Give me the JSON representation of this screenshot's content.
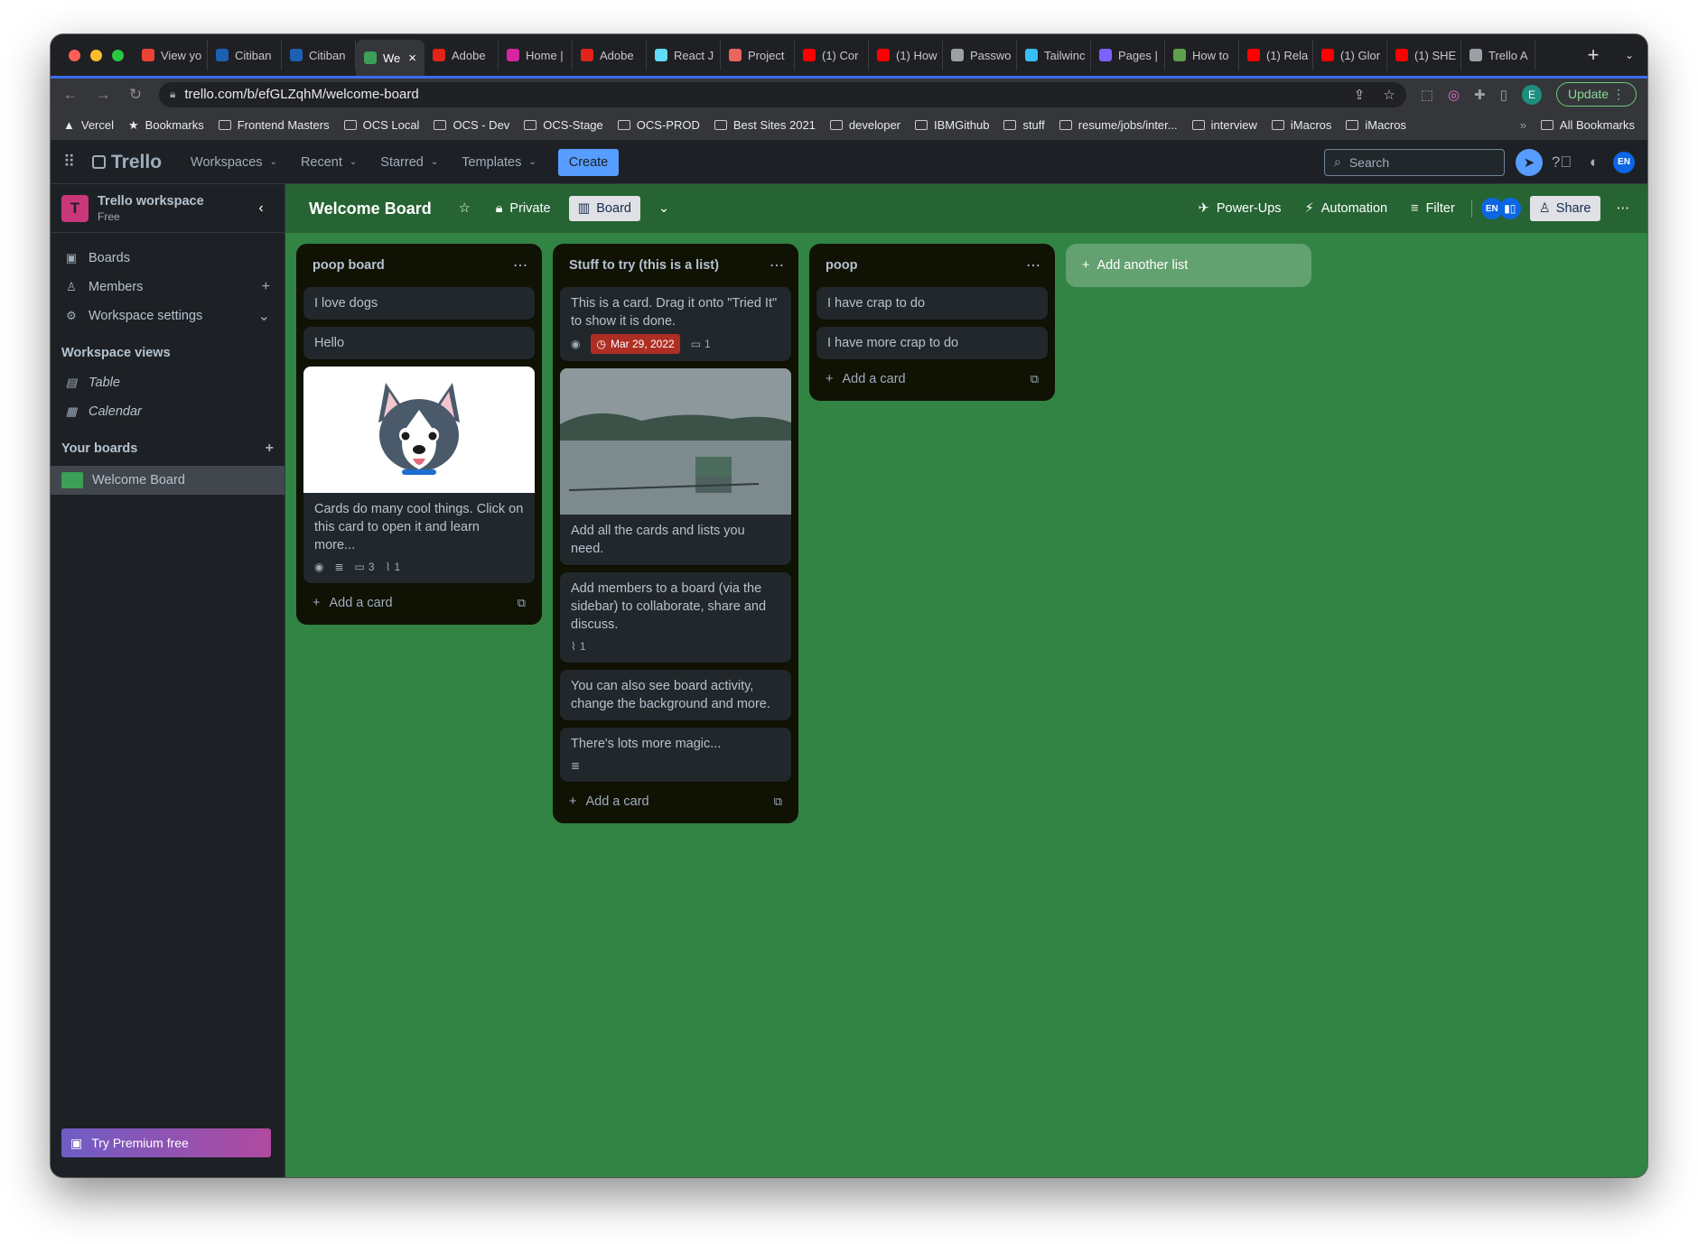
{
  "browser": {
    "tabs": [
      {
        "label": "View yo",
        "icon": "gmail-icon",
        "color": "#ea4335"
      },
      {
        "label": "Citiban",
        "icon": "citi-icon",
        "color": "#1c5fb5"
      },
      {
        "label": "Citiban",
        "icon": "citi-icon",
        "color": "#1c5fb5"
      },
      {
        "label": "We",
        "icon": "trello-icon",
        "color": "#3b9f57",
        "active": true
      },
      {
        "label": "Adobe",
        "icon": "adobe-icon",
        "color": "#e2231a"
      },
      {
        "label": "Home |",
        "icon": "instagram-icon",
        "color": "#d6249f"
      },
      {
        "label": "Adobe",
        "icon": "adobe-icon",
        "color": "#e2231a"
      },
      {
        "label": "React J",
        "icon": "react-icon",
        "color": "#61dafb"
      },
      {
        "label": "Project",
        "icon": "project-icon",
        "color": "#e8665f"
      },
      {
        "label": "(1) Cor",
        "icon": "youtube-icon",
        "color": "#ff0000"
      },
      {
        "label": "(1) How",
        "icon": "youtube-icon",
        "color": "#ff0000"
      },
      {
        "label": "Passwo",
        "icon": "password-icon",
        "color": "#9aa0a6"
      },
      {
        "label": "Tailwinc",
        "icon": "tailwind-icon",
        "color": "#38bdf8"
      },
      {
        "label": "Pages |",
        "icon": "pages-icon",
        "color": "#7b61ff"
      },
      {
        "label": "How to",
        "icon": "nodejs-icon",
        "color": "#5fa04e"
      },
      {
        "label": "(1) Rela",
        "icon": "youtube-icon",
        "color": "#ff0000"
      },
      {
        "label": "(1) Glor",
        "icon": "youtube-icon",
        "color": "#ff0000"
      },
      {
        "label": "(1) SHE",
        "icon": "youtube-icon",
        "color": "#ff0000"
      },
      {
        "label": "Trello A",
        "icon": "globe-icon",
        "color": "#9aa0a6"
      }
    ],
    "url": "trello.com/b/efGLZqhM/welcome-board",
    "profile_initial": "E",
    "update_label": "Update",
    "bookmarks": [
      "Vercel",
      "Bookmarks",
      "Frontend Masters",
      "OCS Local",
      "OCS - Dev",
      "OCS-Stage",
      "OCS-PROD",
      "Best Sites 2021",
      "developer",
      "IBMGithub",
      "stuff",
      "resume/jobs/inter...",
      "interview",
      "iMacros",
      "iMacros"
    ],
    "all_bookmarks": "All Bookmarks",
    "more_bookmarks": "»"
  },
  "header": {
    "logo": "Trello",
    "nav": [
      "Workspaces",
      "Recent",
      "Starred",
      "Templates"
    ],
    "create_label": "Create",
    "search_placeholder": "Search",
    "avatar_initials": "EN"
  },
  "sidebar": {
    "workspace_initial": "T",
    "workspace_name": "Trello workspace",
    "workspace_plan": "Free",
    "items": [
      {
        "label": "Boards",
        "icon": "board-icon"
      },
      {
        "label": "Members",
        "icon": "person-icon",
        "trail": "+"
      },
      {
        "label": "Workspace settings",
        "icon": "gear-icon",
        "trail": "⌄"
      }
    ],
    "views_heading": "Workspace views",
    "views": [
      {
        "label": "Table",
        "icon": "table-icon"
      },
      {
        "label": "Calendar",
        "icon": "calendar-icon"
      }
    ],
    "boards_heading": "Your boards",
    "boards": [
      {
        "label": "Welcome Board",
        "color": "#3b9f57"
      }
    ],
    "premium_label": "Try Premium free"
  },
  "board": {
    "title": "Welcome Board",
    "visibility": "Private",
    "view_label": "Board",
    "powerups": "Power-Ups",
    "automation": "Automation",
    "filter": "Filter",
    "member_initials": "EN",
    "share": "Share",
    "background": "#328444",
    "lists": [
      {
        "title": "poop board",
        "cards": [
          {
            "text": "I love dogs"
          },
          {
            "text": "Hello"
          },
          {
            "text": "Cards do many cool things. Click on this card to open it and learn more...",
            "cover": "husky",
            "watch": true,
            "description": true,
            "comments": "3",
            "attachments": "1"
          }
        ],
        "add_label": "Add a card"
      },
      {
        "title": "Stuff to try (this is a list)",
        "cards": [
          {
            "text": "This is a card. Drag it onto \"Tried It\" to show it is done.",
            "watch": true,
            "due": "Mar 29, 2022",
            "comments": "1"
          },
          {
            "text": "Add all the cards and lists you need.",
            "cover": "lake"
          },
          {
            "text": "Add members to a board (via the sidebar) to collaborate, share and discuss.",
            "attachments": "1"
          },
          {
            "text": "You can also see board activity, change the background and more."
          },
          {
            "text": "There's lots more magic...",
            "description": true
          }
        ],
        "add_label": "Add a card"
      },
      {
        "title": "poop",
        "cards": [
          {
            "text": "I have crap to do"
          },
          {
            "text": "I have more crap to do"
          }
        ],
        "add_label": "Add a card"
      }
    ],
    "add_list_label": "Add another list"
  }
}
